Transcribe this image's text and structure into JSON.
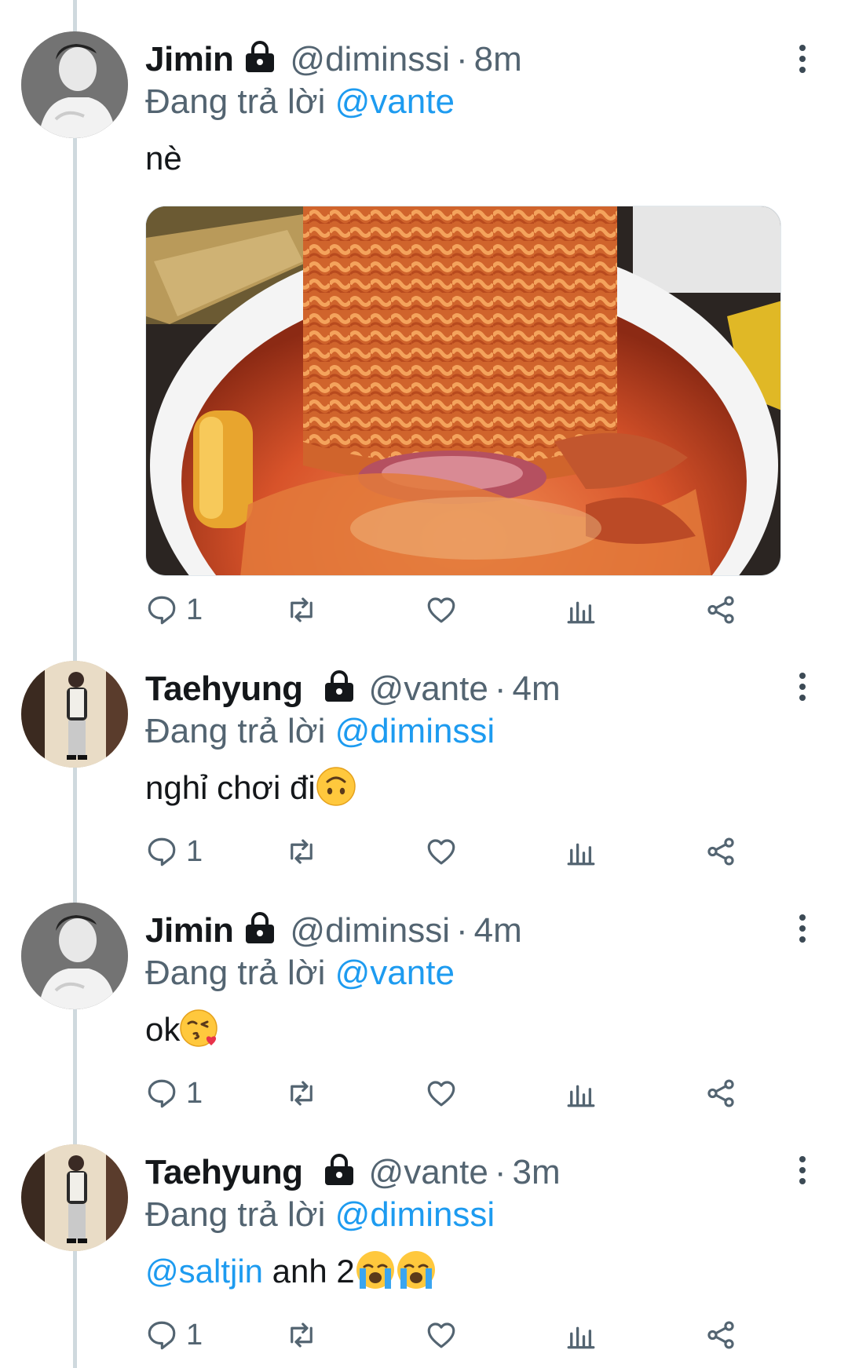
{
  "tweets": [
    {
      "name": "Jimin",
      "handle": "@diminssi",
      "separator": "·",
      "time": "8m",
      "reply_prefix": "Đang trả lời",
      "reply_to": "@vante",
      "text": "nè",
      "has_media": true,
      "replies": "1",
      "avatar": "jimin-avatar"
    },
    {
      "name": "Taehyung",
      "handle": "@vante",
      "separator": "·",
      "time": "4m",
      "reply_prefix": "Đang trả lời",
      "reply_to": "@diminssi",
      "text": "nghỉ chơi đi",
      "text_emoji": "upside-down-face",
      "replies": "1",
      "avatar": "taehyung-avatar"
    },
    {
      "name": "Jimin",
      "handle": "@diminssi",
      "separator": "·",
      "time": "4m",
      "reply_prefix": "Đang trả lời",
      "reply_to": "@vante",
      "text": "ok",
      "text_emoji": "face-blowing-kiss",
      "replies": "1",
      "avatar": "jimin-avatar"
    },
    {
      "name": "Taehyung",
      "handle": "@vante",
      "separator": "·",
      "time": "3m",
      "reply_prefix": "Đang trả lời",
      "reply_to": "@diminssi",
      "text_mention": "@saltjin",
      "text": " anh 2",
      "text_emoji": "loudly-crying-face",
      "replies": "1",
      "avatar": "taehyung-avatar"
    }
  ],
  "colors": {
    "link": "#1d9bf0",
    "secondary_text": "#536471",
    "thread_line": "#cfd9de"
  }
}
